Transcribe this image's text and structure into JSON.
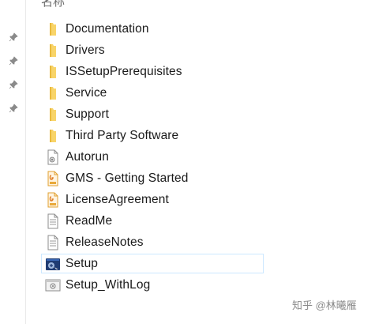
{
  "header": {
    "column_name": "名称"
  },
  "files": [
    {
      "label": "Documentation",
      "icon": "folder-icon"
    },
    {
      "label": "Drivers",
      "icon": "folder-icon"
    },
    {
      "label": "ISSetupPrerequisites",
      "icon": "folder-icon"
    },
    {
      "label": "Service",
      "icon": "folder-icon"
    },
    {
      "label": "Support",
      "icon": "folder-icon"
    },
    {
      "label": "Third Party Software",
      "icon": "folder-icon"
    },
    {
      "label": "Autorun",
      "icon": "autorun-file-icon"
    },
    {
      "label": "GMS - Getting Started",
      "icon": "pdf-file-icon"
    },
    {
      "label": "LicenseAgreement",
      "icon": "pdf-file-icon"
    },
    {
      "label": "ReadMe",
      "icon": "text-file-icon"
    },
    {
      "label": "ReleaseNotes",
      "icon": "text-file-icon"
    },
    {
      "label": "Setup",
      "icon": "setup-exe-icon",
      "selected": true
    },
    {
      "label": "Setup_WithLog",
      "icon": "batch-file-icon"
    }
  ],
  "watermark": "知乎 @林曦雁",
  "colors": {
    "folder": "#f8d469",
    "selection_border": "#cce8ff",
    "text": "#1a1a1a"
  }
}
